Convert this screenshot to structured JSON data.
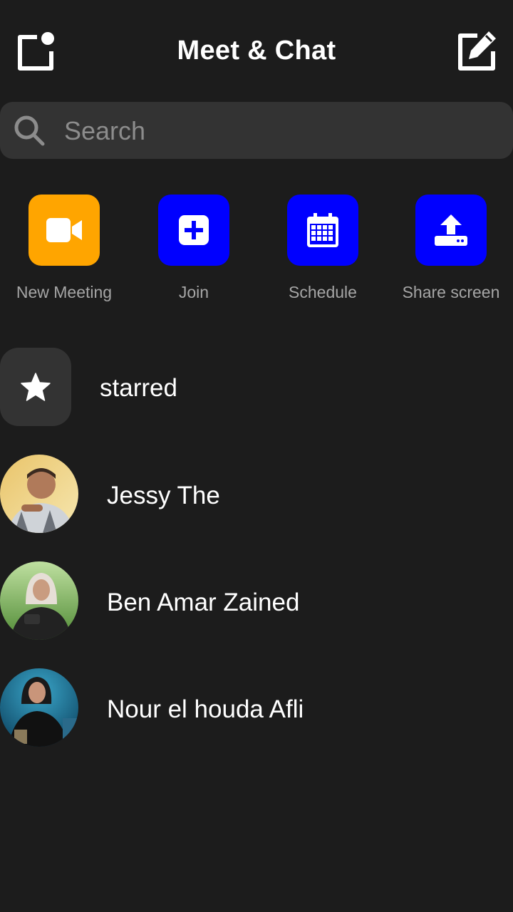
{
  "header": {
    "title": "Meet & Chat",
    "left_icon": "new-window-icon",
    "right_icon": "compose-icon"
  },
  "search": {
    "placeholder": "Search"
  },
  "actions": [
    {
      "label": "New Meeting",
      "icon": "video-camera-icon",
      "color": "#FFA500"
    },
    {
      "label": "Join",
      "icon": "plus-square-icon",
      "color": "#0000FF"
    },
    {
      "label": "Schedule",
      "icon": "calendar-icon",
      "color": "#0000FF"
    },
    {
      "label": "Share screen",
      "icon": "upload-icon",
      "color": "#0000FF"
    }
  ],
  "starred": {
    "label": "starred",
    "icon": "star-icon"
  },
  "contacts": [
    {
      "name": "Jessy The"
    },
    {
      "name": "Ben Amar Zained"
    },
    {
      "name": "Nour el houda Afli"
    }
  ],
  "colors": {
    "background": "#1C1C1C",
    "surface": "#333333",
    "accent_orange": "#FFA500",
    "accent_blue": "#0000FF"
  }
}
